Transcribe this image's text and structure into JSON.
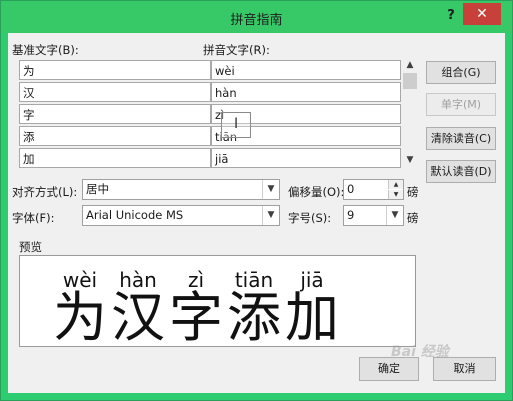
{
  "window": {
    "title": "拼音指南",
    "help": "?",
    "close": "✕"
  },
  "labels": {
    "base_text": "基准文字(B):",
    "ruby_text": "拼音文字(R):",
    "alignment": "对齐方式(L):",
    "offset": "偏移量(O):",
    "offset_unit": "磅",
    "font": "字体(F):",
    "size": "字号(S):",
    "size_unit": "磅",
    "preview": "预览"
  },
  "rows": [
    {
      "base": "为",
      "ruby": "wèi"
    },
    {
      "base": "汉",
      "ruby": "hàn"
    },
    {
      "base": "字",
      "ruby": "zì"
    },
    {
      "base": "添",
      "ruby": "tiān"
    },
    {
      "base": "加",
      "ruby": "jiā"
    }
  ],
  "buttons": {
    "group": "组合(G)",
    "mono": "单字(M)",
    "clear": "清除读音(C)",
    "default": "默认读音(D)",
    "ok": "确定",
    "cancel": "取消"
  },
  "fields": {
    "alignment_value": "居中",
    "offset_value": "0",
    "font_value": "Arial Unicode MS",
    "size_value": "9"
  },
  "preview": {
    "pinyin": [
      "wèi",
      "hàn",
      "zì",
      "tiān",
      "jiā"
    ],
    "hanzi": [
      "为",
      "汉",
      "字",
      "添",
      "加"
    ]
  },
  "watermark": "Bai 经验",
  "colors": {
    "titlebar": "#37c968",
    "close": "#c7403a",
    "client": "#f0f0f0"
  }
}
